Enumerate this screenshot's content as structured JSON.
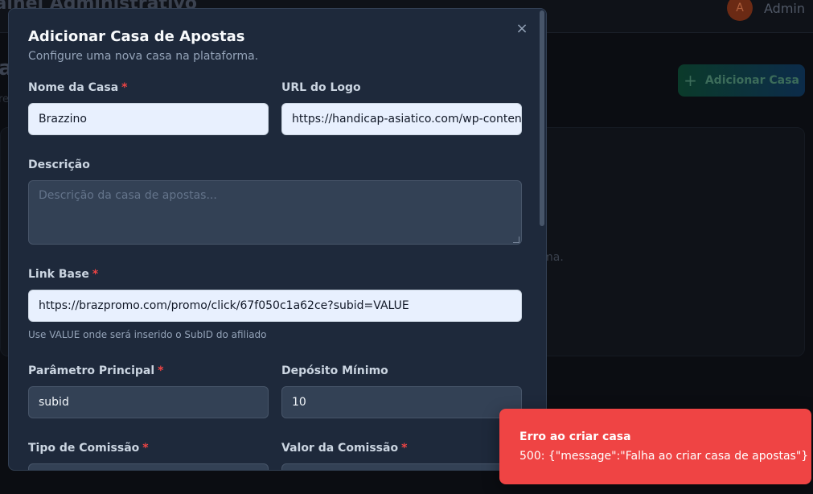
{
  "background": {
    "app_title": "Painel Administrativo",
    "avatar_initial": "A",
    "user_name": "Admin",
    "page_heading_fragment": "a",
    "page_sub_fragment": "re",
    "add_house_button_label": "Adicionar Casa",
    "empty_text": "Nenhuma casa de apostas cadastrada na plataforma."
  },
  "modal": {
    "title": "Adicionar Casa de Apostas",
    "description": "Configure uma nova casa na plataforma.",
    "close_label": "×",
    "required_marker": "*",
    "fields": {
      "name": {
        "label": "Nome da Casa",
        "value": "Brazzino"
      },
      "logo_url": {
        "label": "URL do Logo",
        "value": "https://handicap-asiatico.com/wp-content/uploads"
      },
      "description": {
        "label": "Descrição",
        "placeholder": "Descrição da casa de apostas..."
      },
      "base_link": {
        "label": "Link Base",
        "value": "https://brazpromo.com/promo/click/67f050c1a62ce?subid=VALUE",
        "hint": "Use VALUE onde será inserido o SubID do afiliado"
      },
      "main_param": {
        "label": "Parâmetro Principal",
        "value": "subid"
      },
      "min_deposit": {
        "label": "Depósito Mínimo",
        "value": "10"
      },
      "commission_type": {
        "label": "Tipo de Comissão"
      },
      "commission_value": {
        "label": "Valor da Comissão"
      }
    }
  },
  "toast": {
    "title": "Erro ao criar casa",
    "message": "500: {\"message\":\"Falha ao criar casa de apostas\"}"
  },
  "colors": {
    "modal_bg": "#1e293b",
    "input_dark": "#334155",
    "input_autofill": "#e8f0fe",
    "required": "#ef4444",
    "toast_bg": "#ef4444"
  }
}
